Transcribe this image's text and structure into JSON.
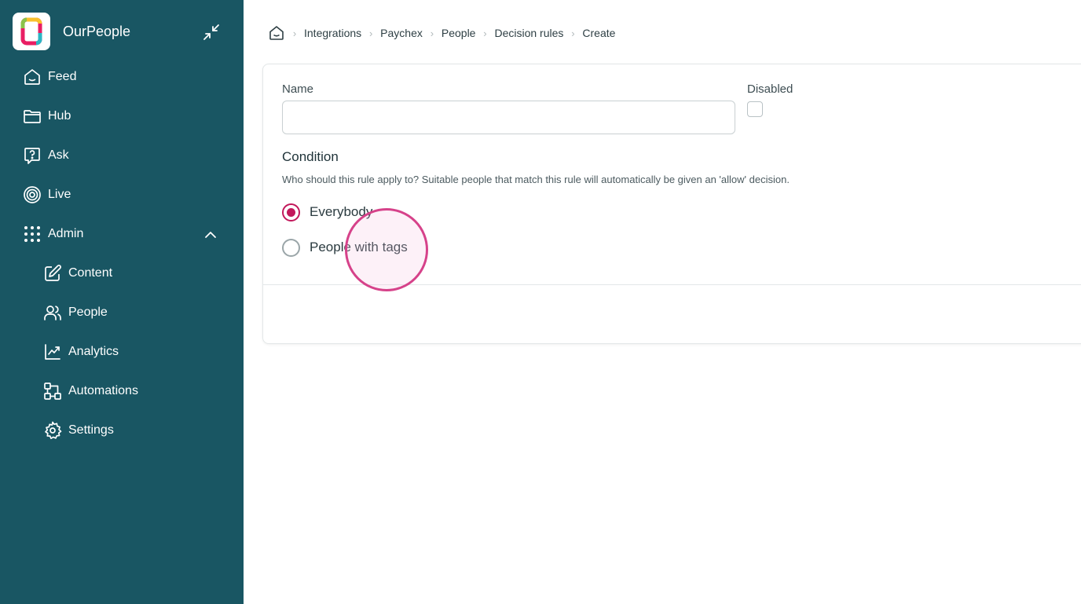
{
  "app": {
    "name": "OurPeople"
  },
  "sidebar": {
    "items": [
      {
        "label": "Feed",
        "icon": "home-icon"
      },
      {
        "label": "Hub",
        "icon": "folder-icon"
      },
      {
        "label": "Ask",
        "icon": "question-icon"
      },
      {
        "label": "Live",
        "icon": "target-icon"
      },
      {
        "label": "Admin",
        "icon": "grid-icon",
        "expanded": true
      },
      {
        "label": "Content",
        "icon": "edit-icon"
      },
      {
        "label": "People",
        "icon": "users-icon"
      },
      {
        "label": "Analytics",
        "icon": "chart-icon"
      },
      {
        "label": "Automations",
        "icon": "automation-icon"
      },
      {
        "label": "Settings",
        "icon": "gear-icon"
      }
    ]
  },
  "breadcrumb": [
    "Integrations",
    "Paychex",
    "People",
    "Decision rules",
    "Create"
  ],
  "form": {
    "name_label": "Name",
    "name_value": "",
    "disabled_label": "Disabled",
    "disabled_checked": false,
    "condition_title": "Condition",
    "condition_hint": "Who should this rule apply to? Suitable people that match this rule will automatically be given an 'allow' decision.",
    "options": [
      {
        "label": "Everybody",
        "selected": true
      },
      {
        "label": "People with tags",
        "selected": false
      }
    ]
  },
  "colors": {
    "sidebar": "#195663",
    "accent": "#c2185b",
    "click_ring": "#d6428a"
  }
}
